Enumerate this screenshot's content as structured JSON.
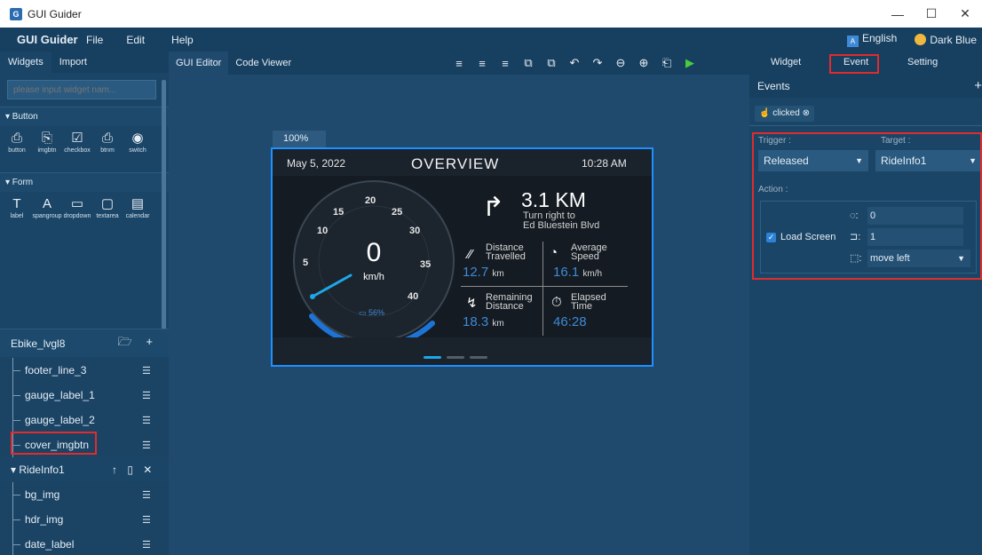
{
  "window": {
    "title": "GUI Guider",
    "app_icon": "gui-guider-logo-icon",
    "minimize": "—",
    "maximize": "☐",
    "close": "✕"
  },
  "menu": {
    "brand": "GUI Guider",
    "items": [
      "File",
      "Edit",
      "Help"
    ],
    "language": "English",
    "theme": "Dark Blue"
  },
  "left": {
    "tabs": [
      "Widgets",
      "Import"
    ],
    "search_placeholder": "please input widget nam...",
    "sections": {
      "button": {
        "title": "▾ Button",
        "items": [
          {
            "label": "button",
            "icon": "⎙"
          },
          {
            "label": "imgbtn",
            "icon": "⎘"
          },
          {
            "label": "checkbox",
            "icon": "☑"
          },
          {
            "label": "btnm",
            "icon": "⎙"
          },
          {
            "label": "switch",
            "icon": "◉"
          }
        ]
      },
      "form": {
        "title": "▾ Form",
        "items": [
          {
            "label": "label",
            "icon": "T"
          },
          {
            "label": "spangroup",
            "icon": "A"
          },
          {
            "label": "dropdown",
            "icon": "▭"
          },
          {
            "label": "textarea",
            "icon": "▢"
          },
          {
            "label": "calendar",
            "icon": "▤"
          }
        ]
      }
    },
    "project": {
      "name": "Ebike_lvgl8",
      "icons": "🗁 +"
    },
    "tree": {
      "items": [
        "footer_line_3",
        "gauge_label_1",
        "gauge_label_2",
        "cover_imgbtn"
      ],
      "group": "RideInfo1",
      "group_icons": "↑ ▯ ✕",
      "children": [
        "bg_img",
        "hdr_img",
        "date_label"
      ]
    }
  },
  "center": {
    "tabs": [
      "GUI Editor",
      "Code Viewer"
    ],
    "tools": [
      "≡",
      "≡",
      "≡",
      "⧉",
      "⧉",
      "↶",
      "↷",
      "⊖",
      "⊕",
      "⎗",
      "▶"
    ],
    "zoom": "100%",
    "screen": {
      "date": "May 5, 2022",
      "title": "OVERVIEW",
      "time": "10:28 AM",
      "speed": "0",
      "speed_unit": "km/h",
      "battery": "56%",
      "ticks": [
        "5",
        "10",
        "15",
        "20",
        "25",
        "30",
        "35",
        "40"
      ],
      "nav_distance": "3.1 KM",
      "nav_line1": "Turn right to",
      "nav_line2": "Ed Bluestein Blvd",
      "cells": [
        {
          "title1": "Distance",
          "title2": "Travelled",
          "value": "12.7",
          "unit": "km"
        },
        {
          "title1": "Average",
          "title2": "Speed",
          "value": "16.1",
          "unit": "km/h"
        },
        {
          "title1": "Remaining",
          "title2": "Distance",
          "value": "18.3",
          "unit": "km"
        },
        {
          "title1": "Elapsed",
          "title2": "Time",
          "value": "46:28",
          "unit": ""
        }
      ]
    }
  },
  "right": {
    "tabs": [
      "Widget",
      "Event",
      "Setting"
    ],
    "events_title": "Events",
    "event_chip": "clicked",
    "trigger_label": "Trigger :",
    "target_label": "Target :",
    "trigger_value": "Released",
    "target_value": "RideInfo1",
    "action_label": "Action :",
    "load_screen": "Load Screen",
    "delay_value": "0",
    "duration_value": "1",
    "animation_value": "move left"
  },
  "colors": {
    "highlight": "#e02c2c",
    "accent": "#1e90ff",
    "panel": "#1b4566"
  }
}
